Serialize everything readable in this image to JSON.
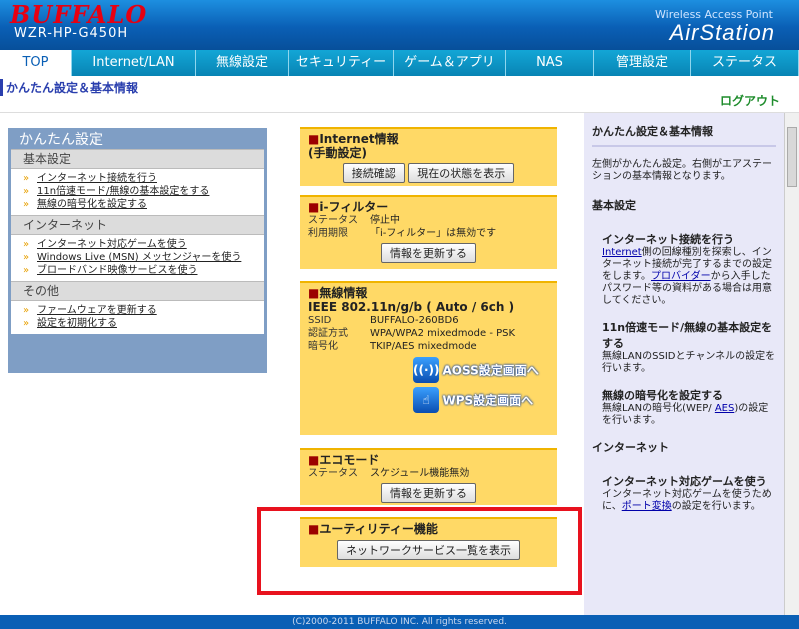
{
  "header": {
    "brand": "BUFFALO",
    "model": "WZR-HP-G450H",
    "wap": "Wireless Access Point",
    "product": "AirStation"
  },
  "nav": {
    "tabs": [
      {
        "label": "TOP",
        "width": 72
      },
      {
        "label": "Internet/LAN",
        "width": 124
      },
      {
        "label": "無線設定",
        "width": 93
      },
      {
        "label": "セキュリティー",
        "width": 105
      },
      {
        "label": "ゲーム＆アプリ",
        "width": 112
      },
      {
        "label": "NAS",
        "width": 88
      },
      {
        "label": "管理設定",
        "width": 97
      },
      {
        "label": "ステータス",
        "width": 108
      }
    ]
  },
  "breadcrumb": "かんたん設定＆基本情報",
  "logout": "ログアウト",
  "quick": {
    "title": "かんたん設定",
    "sections": [
      {
        "head": "基本設定",
        "items": [
          "インターネット接続を行う",
          "11n倍速モード/無線の基本設定をする",
          "無線の暗号化を設定する"
        ]
      },
      {
        "head": "インターネット",
        "items": [
          "インターネット対応ゲームを使う",
          "Windows Live (MSN) メッセンジャーを使う",
          "ブロードバンド映像サービスを使う"
        ]
      },
      {
        "head": "その他",
        "items": [
          "ファームウェアを更新する",
          "設定を初期化する"
        ]
      }
    ]
  },
  "panels": {
    "internet": {
      "title": "Internet情報",
      "sub": "(手動設定)",
      "btn1": "接続確認",
      "btn2": "現在の状態を表示"
    },
    "ifilter": {
      "title": "i-フィルター",
      "rows": [
        [
          "ステータス",
          "停止中"
        ],
        [
          "利用期限",
          "「i-フィルター」は無効です"
        ]
      ],
      "btn": "情報を更新する"
    },
    "wireless": {
      "title": "無線情報",
      "mode": "IEEE 802.11n/g/b ( Auto / 6ch )",
      "rows": [
        [
          "SSID",
          "BUFFALO-260BD6"
        ],
        [
          "認証方式",
          "WPA/WPA2 mixedmode - PSK"
        ],
        [
          "暗号化",
          "TKIP/AES mixedmode"
        ]
      ],
      "aoss": "AOSS設定画面へ",
      "wps": "WPS設定画面へ",
      "aoss_icon": "aoss-icon",
      "wps_icon": "wps-icon"
    },
    "eco": {
      "title": "エコモード",
      "rows": [
        [
          "ステータス",
          "スケジュール機能無効"
        ]
      ],
      "btn": "情報を更新する"
    },
    "utility": {
      "title": "ユーティリティー機能",
      "btn": "ネットワークサービス一覧を表示"
    }
  },
  "help": {
    "title": "かんたん設定＆基本情報",
    "intro": "左側がかんたん設定。右側がエアステーションの基本情報となります。",
    "s1": "基本設定",
    "h1": "インターネット接続を行う",
    "t1a": "Internet",
    "t1b": "側の回線種別を探索し、インターネット接続が完了するまでの設定をします。",
    "t1c": "プロバイダー",
    "t1d": "から入手したパスワード等の資料がある場合は用意してください。",
    "h2": "11n倍速モード/無線の基本設定をする",
    "t2": "無線LANのSSIDとチャンネルの設定を行います。",
    "h3": "無線の暗号化を設定する",
    "t3a": "無線LANの暗号化(WEP/ ",
    "t3b": "AES",
    "t3c": ")の設定を行います。",
    "s2": "インターネット",
    "h4": "インターネット対応ゲームを使う",
    "t4a": "インターネット対応ゲームを使うために、",
    "t4b": "ポート変換",
    "t4c": "の設定を行います。"
  },
  "footer": "(C)2000-2011 BUFFALO INC. All rights reserved."
}
